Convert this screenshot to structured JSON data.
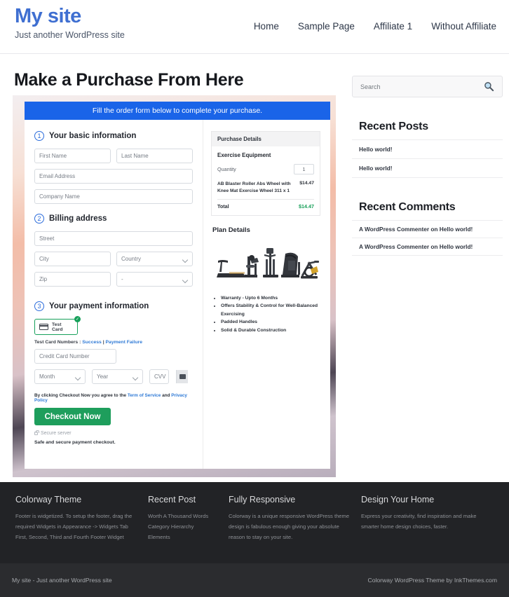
{
  "header": {
    "brand_title": "My site",
    "brand_tagline": "Just another WordPress site",
    "nav": [
      {
        "label": "Home"
      },
      {
        "label": "Sample Page"
      },
      {
        "label": "Affiliate 1"
      },
      {
        "label": "Without Affiliate"
      }
    ]
  },
  "page": {
    "title": "Make a Purchase From Here"
  },
  "form": {
    "banner": "Fill the order form below to complete your purchase.",
    "step1": {
      "number": "1",
      "label": "Your basic information",
      "first_name_placeholder": "First Name",
      "last_name_placeholder": "Last Name",
      "email_placeholder": "Email Address",
      "company_placeholder": "Company Name"
    },
    "step2": {
      "number": "2",
      "label": "Billing address",
      "street_placeholder": "Street",
      "city_placeholder": "City",
      "country_placeholder": "Country",
      "zip_placeholder": "Zip",
      "state_placeholder": "-"
    },
    "step3": {
      "number": "3",
      "label": "Your payment information",
      "card_option_label": "Test Card",
      "card_option_selected": true,
      "check_mark": "✓",
      "test_numbers_prefix": "Test Card Numbers : ",
      "test_success": "Success",
      "test_separator": " | ",
      "test_failure": "Payment Failure",
      "card_number_placeholder": "Credit Card Number",
      "month_placeholder": "Month",
      "year_placeholder": "Year",
      "cvv_placeholder": "CVV"
    },
    "agree_prefix": "By clicking Checkout Now you agree to the ",
    "terms_link": "Term of Service",
    "agree_and": " and ",
    "privacy_link": "Privacy Policy",
    "checkout_label": "Checkout Now",
    "secure_server": "Secure server",
    "safe_note": "Safe and secure payment checkout."
  },
  "purchase_details": {
    "heading": "Purchase Details",
    "product_title": "Exercise Equipment",
    "quantity_label": "Quantity",
    "quantity_value": "1",
    "item_name": "AB Blaster Roller Abs Wheel with Knee Mat Exercise Wheel 311 x 1",
    "item_price": "$14.47",
    "total_label": "Total",
    "total_value": "$14.47"
  },
  "plan_details": {
    "heading": "Plan Details",
    "features": [
      "Warranty - Upto 6 Months",
      "Offers Stability & Control for Well-Balanced Exercising",
      "Padded Handles",
      "Solid & Durable Construction"
    ]
  },
  "sidebar": {
    "search_placeholder": "Search",
    "recent_posts_title": "Recent Posts",
    "recent_posts": [
      {
        "label": "Hello world!"
      },
      {
        "label": "Hello world!"
      }
    ],
    "recent_comments_title": "Recent Comments",
    "recent_comments": [
      {
        "label": "A WordPress Commenter on Hello world!"
      },
      {
        "label": "A WordPress Commenter on Hello world!"
      }
    ]
  },
  "footer": {
    "columns": [
      {
        "title": "Colorway Theme",
        "text": "Footer is widgetized. To setup the footer, drag the required Widgets in Appearance -> Widgets Tab First, Second, Third and Fourth Footer Widget"
      },
      {
        "title": "Recent Post",
        "items": [
          {
            "label": "Worth A Thousand Words"
          },
          {
            "label": "Category Hierarchy"
          },
          {
            "label": "Elements"
          }
        ]
      },
      {
        "title": "Fully Responsive",
        "text": "Colorway is a unique responsive WordPress theme design is fabulous enough giving your absolute reason to stay on your site."
      },
      {
        "title": "Design Your Home",
        "text": "Express your creativity, find inspiration and make smarter home design choices, faster."
      }
    ],
    "copyright_left": "My site - Just another WordPress site",
    "copyright_right": "Colorway WordPress Theme by InkThemes.com"
  },
  "colors": {
    "brand": "#3f6fd1",
    "banner_blue": "#1a64e8",
    "success_green": "#1e9e5c",
    "total_green": "#19a05a",
    "link_blue": "#2f7ad6",
    "footer_bg": "#222326",
    "copyright_bg": "#2b2c2f"
  }
}
